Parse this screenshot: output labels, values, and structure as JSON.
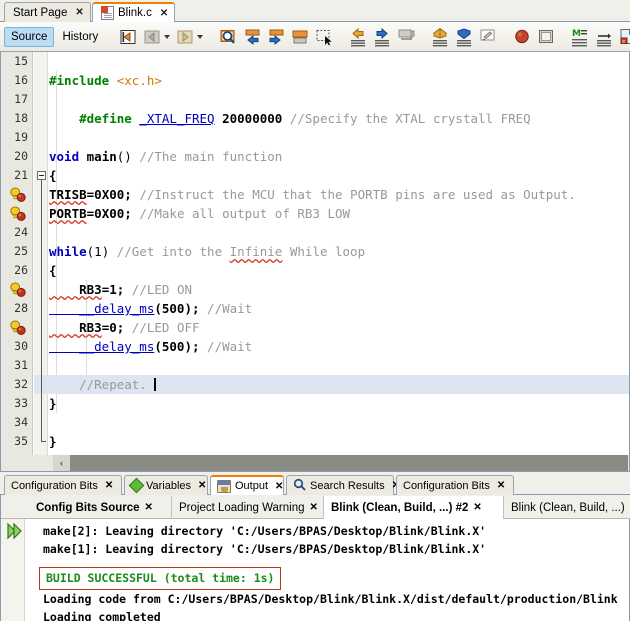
{
  "window": {
    "accent_orange": "#f08000",
    "selection_blue": "#dde4f2"
  },
  "editor_tabs": [
    {
      "label": "Start Page",
      "close": "✕",
      "active": false,
      "has_icon": false
    },
    {
      "label": "Blink.c",
      "close": "✕",
      "active": true,
      "has_icon": true
    }
  ],
  "editor_toolbar": {
    "source_label": "Source",
    "history_label": "History",
    "icons": [
      "last-edit-icon",
      "back-icon",
      "back-dropdown-icon",
      "forward-icon",
      "forward-dropdown-icon",
      "find-selection-icon",
      "previous-bookmark-icon",
      "next-bookmark-icon",
      "toggle-bookmark-icon",
      "toggle-rectangular-selection-icon",
      "shift-line-left-icon",
      "shift-line-right-icon",
      "start-macro-recording-icon",
      "stop-macro-recording-icon",
      "comment-icon",
      "uncomment-icon",
      "toggle-highlight-icon",
      "inspect-members-icon",
      "toggle-line-numbers-icon"
    ]
  },
  "code": {
    "lines": [
      {
        "num": "15",
        "gutter": "number",
        "indent": 0,
        "fold": "",
        "segments": []
      },
      {
        "num": "16",
        "gutter": "number",
        "indent": 0,
        "fold": "",
        "segments": [
          {
            "t": "#include ",
            "c": "pp"
          },
          {
            "t": "<xc.h>",
            "c": "str"
          }
        ]
      },
      {
        "num": "17",
        "gutter": "number",
        "indent": 0,
        "fold": "",
        "segments": []
      },
      {
        "num": "18",
        "gutter": "number",
        "indent": 0,
        "fold": "",
        "segments": [
          {
            "t": "    #define ",
            "c": "pp"
          },
          {
            "t": "_XTAL_FREQ",
            "c": "id"
          },
          {
            "t": " ",
            "c": ""
          },
          {
            "t": "20000000",
            "c": "num"
          },
          {
            "t": " //Specify the XTAL crystall FREQ",
            "c": "cm"
          }
        ]
      },
      {
        "num": "19",
        "gutter": "number",
        "indent": 0,
        "fold": "",
        "segments": []
      },
      {
        "num": "20",
        "gutter": "number",
        "indent": 0,
        "fold": "",
        "segments": [
          {
            "t": "void ",
            "c": "k"
          },
          {
            "t": "main",
            "c": "idb"
          },
          {
            "t": "() ",
            "c": ""
          },
          {
            "t": "//The main function",
            "c": "cm"
          }
        ]
      },
      {
        "num": "21",
        "gutter": "number",
        "indent": 0,
        "fold": "box",
        "segments": [
          {
            "t": "{",
            "c": "b"
          }
        ]
      },
      {
        "num": "22",
        "gutter": "bulb",
        "indent": 0,
        "fold": "line",
        "segments": [
          {
            "t": "TRISB",
            "c": "b wavy2"
          },
          {
            "t": "=0X00; ",
            "c": "b"
          },
          {
            "t": "//Instruct the MCU that the PORTB pins are used as Output.",
            "c": "cm"
          }
        ]
      },
      {
        "num": "23",
        "gutter": "bulb",
        "indent": 0,
        "fold": "line",
        "segments": [
          {
            "t": "PORTB",
            "c": "b wavy2"
          },
          {
            "t": "=0X00; ",
            "c": "b"
          },
          {
            "t": "//Make all output of RB3 LOW",
            "c": "cm"
          }
        ]
      },
      {
        "num": "24",
        "gutter": "number",
        "indent": 0,
        "fold": "line",
        "segments": []
      },
      {
        "num": "25",
        "gutter": "number",
        "indent": 0,
        "fold": "line",
        "segments": [
          {
            "t": "while",
            "c": "k"
          },
          {
            "t": "(1) ",
            "c": ""
          },
          {
            "t": "//Get into the ",
            "c": "cm"
          },
          {
            "t": "Infinie",
            "c": "cm wavy"
          },
          {
            "t": " While loop",
            "c": "cm"
          }
        ]
      },
      {
        "num": "26",
        "gutter": "number",
        "indent": 0,
        "fold": "line",
        "segments": [
          {
            "t": "{",
            "c": "b"
          }
        ]
      },
      {
        "num": "27",
        "gutter": "bulb",
        "indent": 1,
        "fold": "line",
        "segments": [
          {
            "t": "    RB3",
            "c": "b wavy2"
          },
          {
            "t": "=1; ",
            "c": "b"
          },
          {
            "t": "//LED ON",
            "c": "cm"
          }
        ]
      },
      {
        "num": "28",
        "gutter": "number",
        "indent": 1,
        "fold": "line",
        "segments": [
          {
            "t": "    __delay_ms",
            "c": "id"
          },
          {
            "t": "(500); ",
            "c": "b"
          },
          {
            "t": "//Wait",
            "c": "cm"
          }
        ]
      },
      {
        "num": "29",
        "gutter": "bulb",
        "indent": 1,
        "fold": "line",
        "segments": [
          {
            "t": "    RB3",
            "c": "b wavy2"
          },
          {
            "t": "=0; ",
            "c": "b"
          },
          {
            "t": "//LED OFF",
            "c": "cm"
          }
        ]
      },
      {
        "num": "30",
        "gutter": "number",
        "indent": 1,
        "fold": "line",
        "segments": [
          {
            "t": "    __delay_ms",
            "c": "id"
          },
          {
            "t": "(500); ",
            "c": "b"
          },
          {
            "t": "//Wait",
            "c": "cm"
          }
        ]
      },
      {
        "num": "31",
        "gutter": "number",
        "indent": 1,
        "fold": "line",
        "segments": []
      },
      {
        "num": "32",
        "gutter": "number",
        "indent": 1,
        "fold": "line",
        "highlight": true,
        "caret": true,
        "segments": [
          {
            "t": "    //Repeat. ",
            "c": "cm"
          }
        ]
      },
      {
        "num": "33",
        "gutter": "number",
        "indent": 0,
        "fold": "line",
        "segments": [
          {
            "t": "}",
            "c": "b"
          }
        ]
      },
      {
        "num": "34",
        "gutter": "number",
        "indent": 0,
        "fold": "line",
        "segments": []
      },
      {
        "num": "35",
        "gutter": "number",
        "indent": 0,
        "fold": "end",
        "segments": [
          {
            "t": "}",
            "c": "b"
          }
        ]
      }
    ]
  },
  "scrollbar": {
    "left_arrow": "‹"
  },
  "bottom_tabs": [
    {
      "label": "Configuration Bits",
      "close": "✕",
      "icon": "none",
      "active": false
    },
    {
      "label": "Variables",
      "close": "✕",
      "icon": "diamond",
      "active": false
    },
    {
      "label": "Output",
      "close": "✕",
      "icon": "output",
      "active": true
    },
    {
      "label": "Search Results",
      "close": "✕",
      "icon": "search",
      "active": false
    },
    {
      "label": "Configuration Bits",
      "close": "✕",
      "icon": "none",
      "active": false
    }
  ],
  "output_tabs": [
    {
      "label": "Config Bits Source",
      "close": "✕",
      "active": false,
      "bold": true
    },
    {
      "label": "Project Loading Warning",
      "close": "✕",
      "active": false,
      "bold": false
    },
    {
      "label": "Blink (Clean, Build, ...) #2",
      "close": "✕",
      "active": true,
      "bold": true
    },
    {
      "label": "Blink (Clean, Build, ...)",
      "close": "✕",
      "active": false,
      "bold": false
    }
  ],
  "console": {
    "run_icon": "run-icon",
    "lines": [
      {
        "text": "make[2]: Leaving directory 'C:/Users/BPAS/Desktop/Blink/Blink.X'",
        "kind": "plain"
      },
      {
        "text": "make[1]: Leaving directory 'C:/Users/BPAS/Desktop/Blink/Blink.X'",
        "kind": "plain"
      },
      {
        "text": "",
        "kind": "blank"
      },
      {
        "text": "BUILD SUCCESSFUL (total time: 1s)",
        "kind": "build_success"
      },
      {
        "text": "Loading code from C:/Users/BPAS/Desktop/Blink/Blink.X/dist/default/production/Blink",
        "kind": "plain"
      },
      {
        "text": "Loading completed",
        "kind": "plain"
      }
    ],
    "build_text_color": "#1a8a1a",
    "build_border_color": "#b03a1a"
  }
}
